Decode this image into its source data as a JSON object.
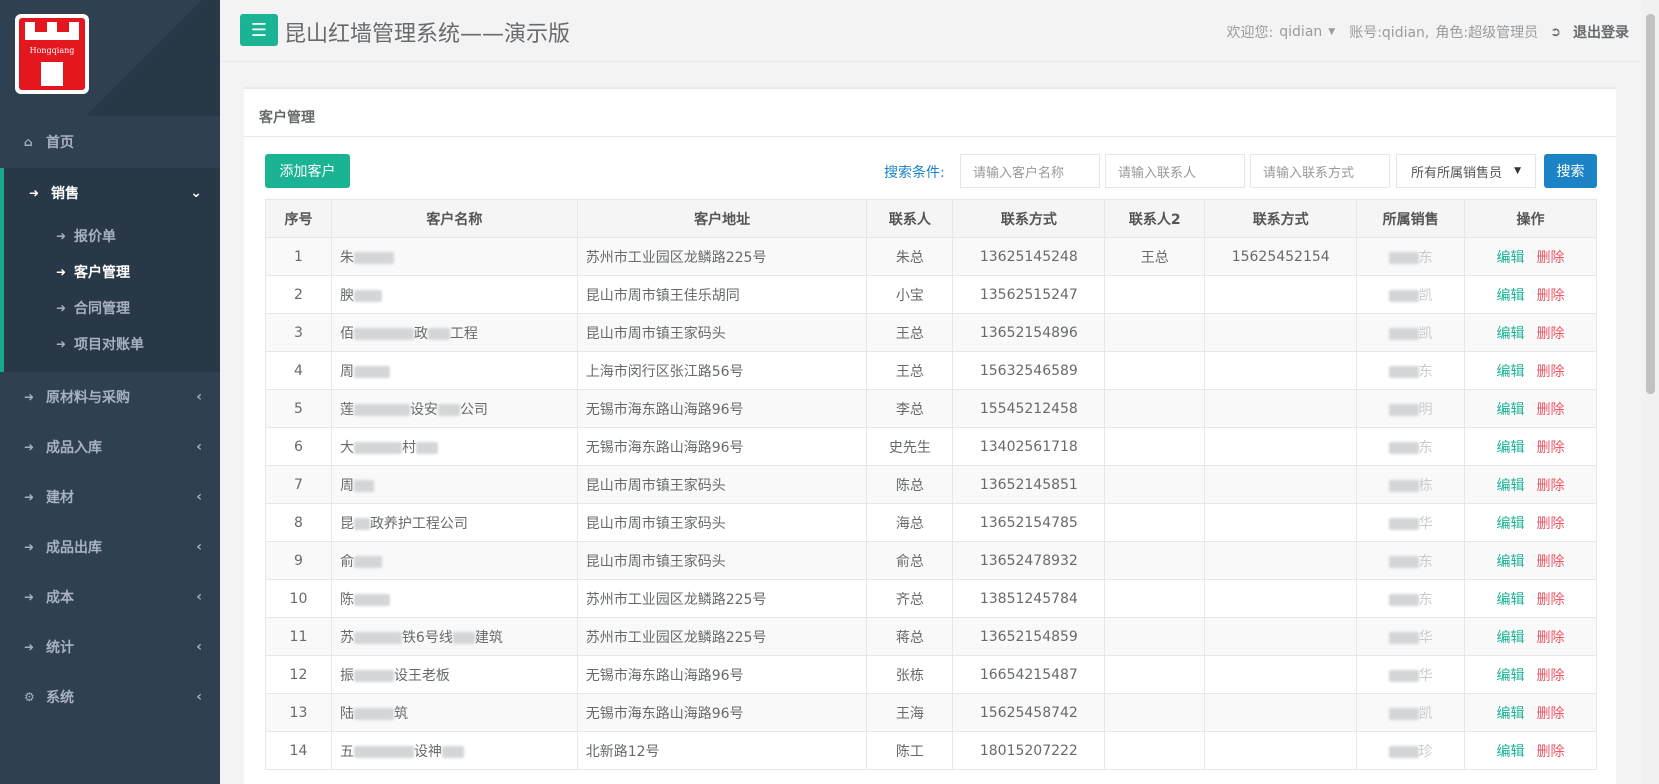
{
  "app": {
    "title": "昆山红墙管理系统——演示版",
    "logo_text": "Hongqiang"
  },
  "header": {
    "welcome_label": "欢迎您:",
    "username": "qidian",
    "account_label": "账号:qidian,",
    "role_label": "角色:超级管理员",
    "logout_label": "退出登录"
  },
  "sidebar": {
    "home": "首页",
    "sales": "销售",
    "sales_children": [
      "报价单",
      "客户管理",
      "合同管理",
      "项目对账单"
    ],
    "materials": "原材料与采购",
    "inbound": "成品入库",
    "building": "建材",
    "outbound": "成品出库",
    "cost": "成本",
    "stats": "统计",
    "system": "系统"
  },
  "panel": {
    "title": "客户管理",
    "add_button": "添加客户",
    "search_label": "搜索条件:",
    "placeholder_name": "请输入客户名称",
    "placeholder_contact": "请输入联系人",
    "placeholder_phone": "请输入联系方式",
    "sales_select": "所有所属销售员",
    "search_button": "搜索"
  },
  "table": {
    "headers": [
      "序号",
      "客户名称",
      "客户地址",
      "联系人",
      "联系方式",
      "联系人2",
      "联系方式",
      "所属销售",
      "操作"
    ],
    "edit_label": "编辑",
    "delete_label": "删除",
    "rows": [
      {
        "no": "1",
        "name_a": "朱",
        "name_b": "",
        "address": "苏州市工业园区龙鳞路225号",
        "contact": "朱总",
        "phone": "13625145248",
        "contact2": "王总",
        "phone2": "15625452154",
        "sales_tail": "东"
      },
      {
        "no": "2",
        "name_a": "腴",
        "name_b": "",
        "address": "昆山市周市镇王佳乐胡同",
        "contact": "小宝",
        "phone": "13562515247",
        "contact2": "",
        "phone2": "",
        "sales_tail": "凯"
      },
      {
        "no": "3",
        "name_a": "佰",
        "name_b": "政",
        "name_c": "工程",
        "address": "昆山市周市镇王家码头",
        "contact": "王总",
        "phone": "13652154896",
        "contact2": "",
        "phone2": "",
        "sales_tail": "凯"
      },
      {
        "no": "4",
        "name_a": "周",
        "name_b": "",
        "address": "上海市闵行区张江路56号",
        "contact": "王总",
        "phone": "15632546589",
        "contact2": "",
        "phone2": "",
        "sales_tail": "东"
      },
      {
        "no": "5",
        "name_a": "莲",
        "name_b": "设安",
        "name_c": "公司",
        "address": "无锡市海东路山海路96号",
        "contact": "李总",
        "phone": "15545212458",
        "contact2": "",
        "phone2": "",
        "sales_tail": "明"
      },
      {
        "no": "6",
        "name_a": "大",
        "name_b": "村",
        "name_c": "",
        "address": "无锡市海东路山海路96号",
        "contact": "史先生",
        "phone": "13402561718",
        "contact2": "",
        "phone2": "",
        "sales_tail": "东"
      },
      {
        "no": "7",
        "name_a": "周",
        "name_b": "",
        "address": "昆山市周市镇王家码头",
        "contact": "陈总",
        "phone": "13652145851",
        "contact2": "",
        "phone2": "",
        "sales_tail": "栋"
      },
      {
        "no": "8",
        "name_a": "昆",
        "name_b": "政养护工程公司",
        "address": "昆山市周市镇王家码头",
        "contact": "海总",
        "phone": "13652154785",
        "contact2": "",
        "phone2": "",
        "sales_tail": "华"
      },
      {
        "no": "9",
        "name_a": "俞",
        "name_b": "",
        "address": "昆山市周市镇王家码头",
        "contact": "俞总",
        "phone": "13652478932",
        "contact2": "",
        "phone2": "",
        "sales_tail": "东"
      },
      {
        "no": "10",
        "name_a": "陈",
        "name_b": "",
        "address": "苏州市工业园区龙鳞路225号",
        "contact": "齐总",
        "phone": "13851245784",
        "contact2": "",
        "phone2": "",
        "sales_tail": "东"
      },
      {
        "no": "11",
        "name_a": "苏",
        "name_b": "铁6号线",
        "name_c": "建筑",
        "address": "苏州市工业园区龙鳞路225号",
        "contact": "蒋总",
        "phone": "13652154859",
        "contact2": "",
        "phone2": "",
        "sales_tail": "华"
      },
      {
        "no": "12",
        "name_a": "振",
        "name_b": "设王老板",
        "address": "无锡市海东路山海路96号",
        "contact": "张栋",
        "phone": "16654215487",
        "contact2": "",
        "phone2": "",
        "sales_tail": "华"
      },
      {
        "no": "13",
        "name_a": "陆",
        "name_b": "筑",
        "address": "无锡市海东路山海路96号",
        "contact": "王海",
        "phone": "15625458742",
        "contact2": "",
        "phone2": "",
        "sales_tail": "凯"
      },
      {
        "no": "14",
        "name_a": "五",
        "name_b": "设神",
        "name_c": "",
        "address": "北新路12号",
        "contact": "陈工",
        "phone": "18015207222",
        "contact2": "",
        "phone2": "",
        "sales_tail": "珍"
      }
    ]
  },
  "colors": {
    "sidebar_bg": "#2f4050",
    "accent_green": "#1ab394",
    "accent_blue": "#1c84c6",
    "delete_red": "#ed5565"
  }
}
